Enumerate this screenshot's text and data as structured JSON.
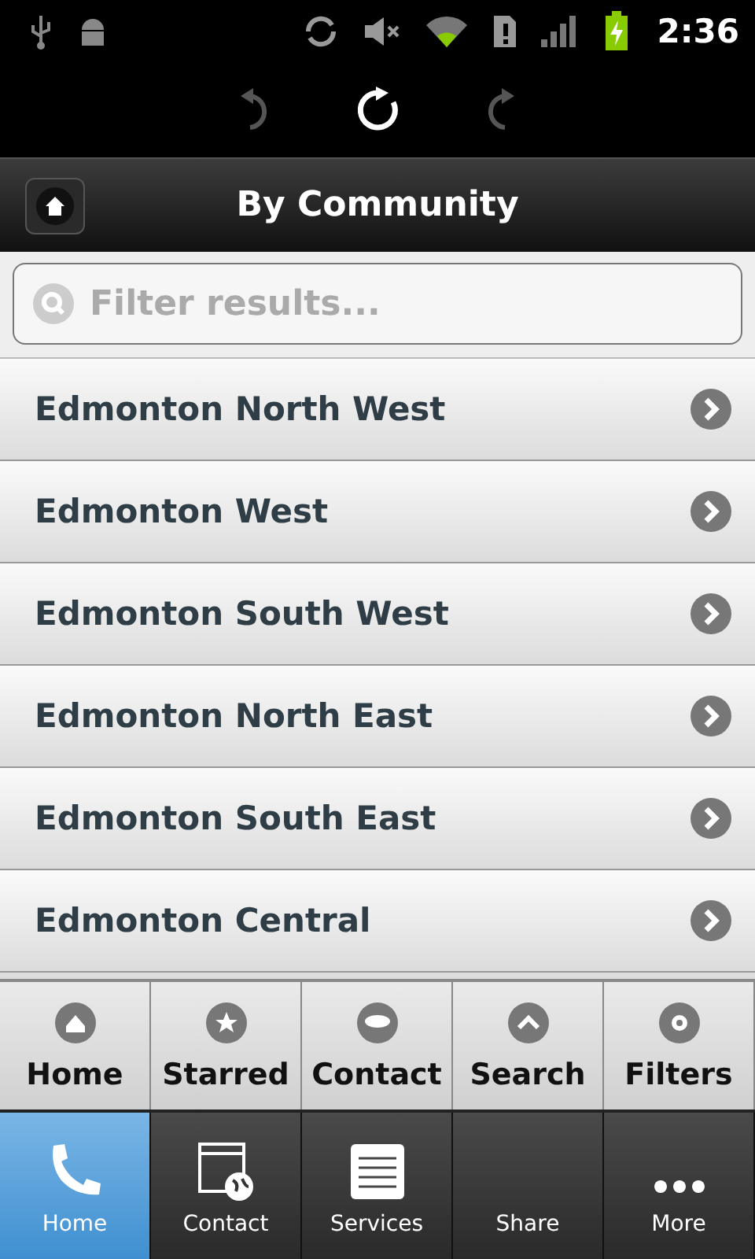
{
  "status_bar": {
    "time": "2:36"
  },
  "header": {
    "title": "By Community"
  },
  "search": {
    "placeholder": "Filter results..."
  },
  "list": [
    {
      "label": "Edmonton North West"
    },
    {
      "label": "Edmonton West"
    },
    {
      "label": "Edmonton South West"
    },
    {
      "label": "Edmonton North East"
    },
    {
      "label": "Edmonton South East"
    },
    {
      "label": "Edmonton Central"
    }
  ],
  "toolbar": [
    {
      "label": "Home"
    },
    {
      "label": "Starred"
    },
    {
      "label": "Contact"
    },
    {
      "label": "Search"
    },
    {
      "label": "Filters"
    }
  ],
  "tab_bar": [
    {
      "label": "Home",
      "selected": true
    },
    {
      "label": "Contact",
      "selected": false
    },
    {
      "label": "Services",
      "selected": false
    },
    {
      "label": "Share",
      "selected": false
    },
    {
      "label": "More",
      "selected": false
    }
  ]
}
